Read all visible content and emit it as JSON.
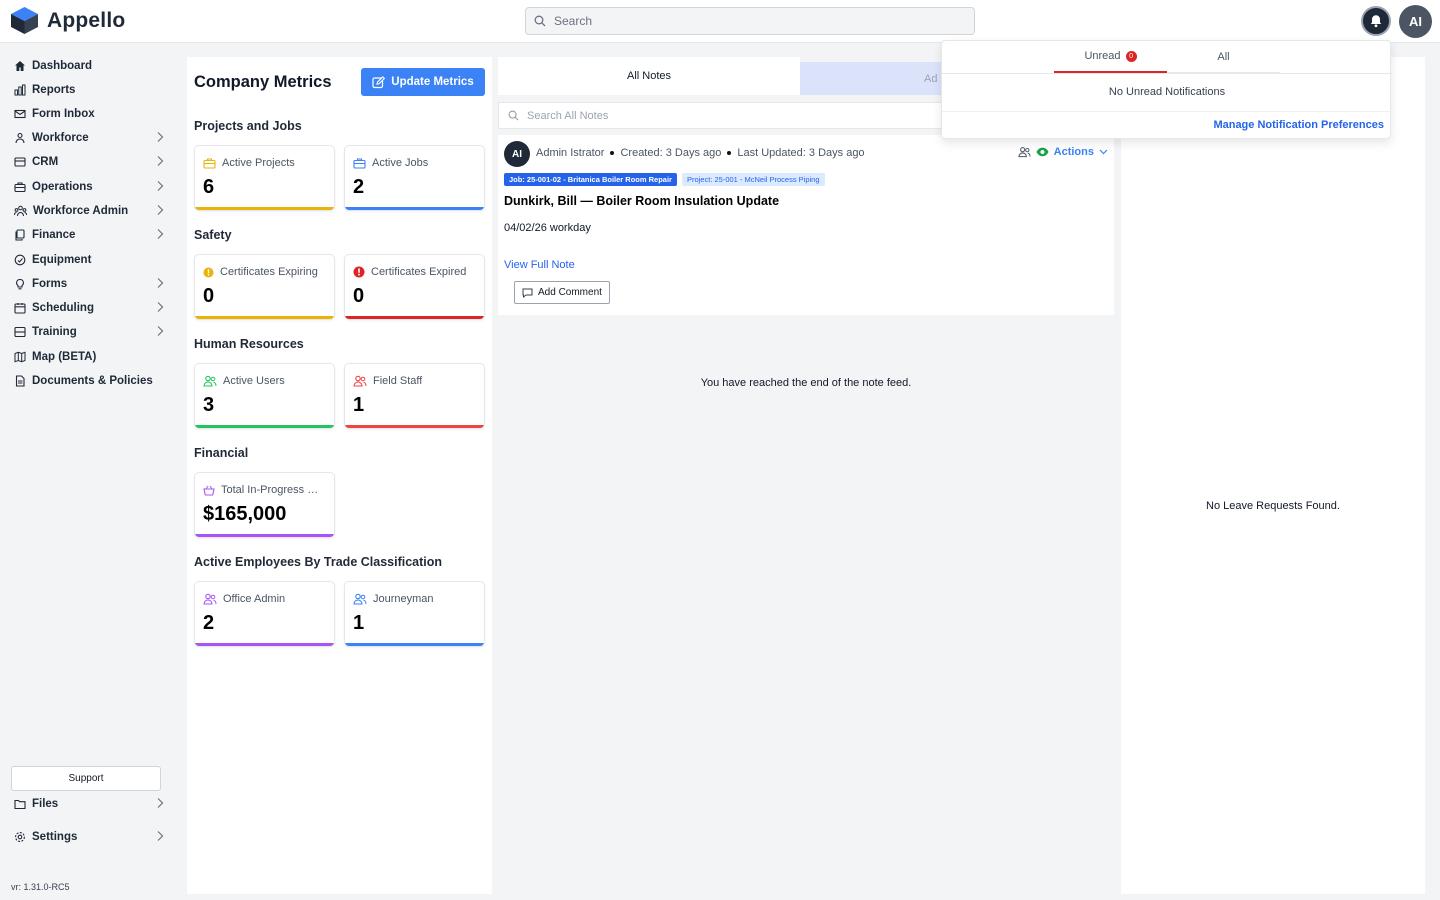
{
  "app": {
    "name": "Appello"
  },
  "search": {
    "placeholder": "Search"
  },
  "user": {
    "initials": "AI"
  },
  "sidebar": {
    "items": [
      {
        "label": "Dashboard",
        "icon": "home-icon",
        "has_children": false
      },
      {
        "label": "Reports",
        "icon": "chart-icon",
        "has_children": false
      },
      {
        "label": "Form Inbox",
        "icon": "inbox-icon",
        "has_children": false
      },
      {
        "label": "Workforce",
        "icon": "people-icon",
        "has_children": true
      },
      {
        "label": "CRM",
        "icon": "crm-icon",
        "has_children": true
      },
      {
        "label": "Operations",
        "icon": "briefcase-icon",
        "has_children": true
      },
      {
        "label": "Workforce Admin",
        "icon": "group-icon",
        "has_children": true
      },
      {
        "label": "Finance",
        "icon": "copy-icon",
        "has_children": true
      },
      {
        "label": "Equipment",
        "icon": "gauge-icon",
        "has_children": false
      },
      {
        "label": "Forms",
        "icon": "bulb-icon",
        "has_children": true
      },
      {
        "label": "Scheduling",
        "icon": "calendar-icon",
        "has_children": true
      },
      {
        "label": "Training",
        "icon": "layers-icon",
        "has_children": true
      },
      {
        "label": "Map (BETA)",
        "icon": "map-icon",
        "has_children": false
      },
      {
        "label": "Documents & Policies",
        "icon": "document-icon",
        "has_children": false
      }
    ],
    "support_label": "Support",
    "files_label": "Files",
    "settings_label": "Settings",
    "version": "vr: 1.31.0-RC5"
  },
  "metrics": {
    "title": "Company Metrics",
    "update_label": "Update Metrics",
    "sections": {
      "projects": "Projects and Jobs",
      "safety": "Safety",
      "hr": "Human Resources",
      "financial": "Financial",
      "trades": "Active Employees By Trade Classification"
    },
    "cards": {
      "active_projects": {
        "label": "Active Projects",
        "value": "6",
        "color": "#eab308"
      },
      "active_jobs": {
        "label": "Active Jobs",
        "value": "2",
        "color": "#3b82f6"
      },
      "certs_expiring": {
        "label": "Certificates Expiring",
        "value": "0",
        "color": "#eab308"
      },
      "certs_expired": {
        "label": "Certificates Expired",
        "value": "0",
        "color": "#dc2626"
      },
      "active_users": {
        "label": "Active Users",
        "value": "3",
        "color": "#22c55e"
      },
      "field_staff": {
        "label": "Field Staff",
        "value": "1",
        "color": "#ef4444"
      },
      "total_in_progress": {
        "label": "Total In-Progress Value",
        "value": "$165,000",
        "color": "#a855f7"
      },
      "office_admin": {
        "label": "Office Admin",
        "value": "2",
        "color": "#a855f7"
      },
      "journeyman": {
        "label": "Journeyman",
        "value": "1",
        "color": "#3b82f6"
      }
    }
  },
  "notes": {
    "tab_all": "All Notes",
    "tab_add": "Ad",
    "search_placeholder": "Search All Notes",
    "note": {
      "author_initials": "AI",
      "author": "Admin Istrator",
      "created": "Created: 3 Days ago",
      "updated": "Last Updated: 3 Days ago",
      "actions_label": "Actions",
      "tag_job": "Job: 25-001-02 - Britanica Boiler Room Repair",
      "tag_project": "Project: 25-001 - McNeil Process Piping",
      "title": "Dunkirk, Bill — Boiler Room Insulation Update",
      "body": "04/02/26 workday",
      "view_label": "View Full Note",
      "comment_label": "Add Comment"
    },
    "feed_end": "You have reached the end of the note feed."
  },
  "leave": {
    "empty": "No Leave Requests Found."
  },
  "notifications": {
    "tab_unread": "Unread",
    "unread_count": "0",
    "tab_all": "All",
    "empty": "No Unread Notifications",
    "manage_label": "Manage Notification Preferences"
  },
  "colors": {
    "accent": "#3b82f6",
    "alert": "#dc2626",
    "dark": "#1f2937"
  }
}
